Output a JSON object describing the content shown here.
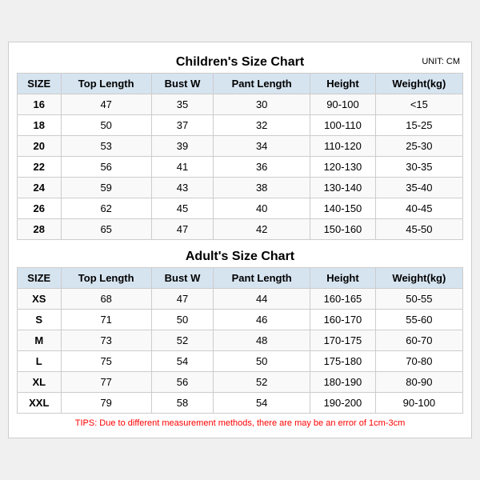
{
  "childrenChart": {
    "title": "Children's Size Chart",
    "unit": "UNIT: CM",
    "headers": [
      "SIZE",
      "Top Length",
      "Bust W",
      "Pant Length",
      "Height",
      "Weight(kg)"
    ],
    "rows": [
      [
        "16",
        "47",
        "35",
        "30",
        "90-100",
        "<15"
      ],
      [
        "18",
        "50",
        "37",
        "32",
        "100-110",
        "15-25"
      ],
      [
        "20",
        "53",
        "39",
        "34",
        "110-120",
        "25-30"
      ],
      [
        "22",
        "56",
        "41",
        "36",
        "120-130",
        "30-35"
      ],
      [
        "24",
        "59",
        "43",
        "38",
        "130-140",
        "35-40"
      ],
      [
        "26",
        "62",
        "45",
        "40",
        "140-150",
        "40-45"
      ],
      [
        "28",
        "65",
        "47",
        "42",
        "150-160",
        "45-50"
      ]
    ]
  },
  "adultChart": {
    "title": "Adult's Size Chart",
    "headers": [
      "SIZE",
      "Top Length",
      "Bust W",
      "Pant Length",
      "Height",
      "Weight(kg)"
    ],
    "rows": [
      [
        "XS",
        "68",
        "47",
        "44",
        "160-165",
        "50-55"
      ],
      [
        "S",
        "71",
        "50",
        "46",
        "160-170",
        "55-60"
      ],
      [
        "M",
        "73",
        "52",
        "48",
        "170-175",
        "60-70"
      ],
      [
        "L",
        "75",
        "54",
        "50",
        "175-180",
        "70-80"
      ],
      [
        "XL",
        "77",
        "56",
        "52",
        "180-190",
        "80-90"
      ],
      [
        "XXL",
        "79",
        "58",
        "54",
        "190-200",
        "90-100"
      ]
    ]
  },
  "tips": "TIPS: Due to different measurement methods, there are may be an error of 1cm-3cm"
}
